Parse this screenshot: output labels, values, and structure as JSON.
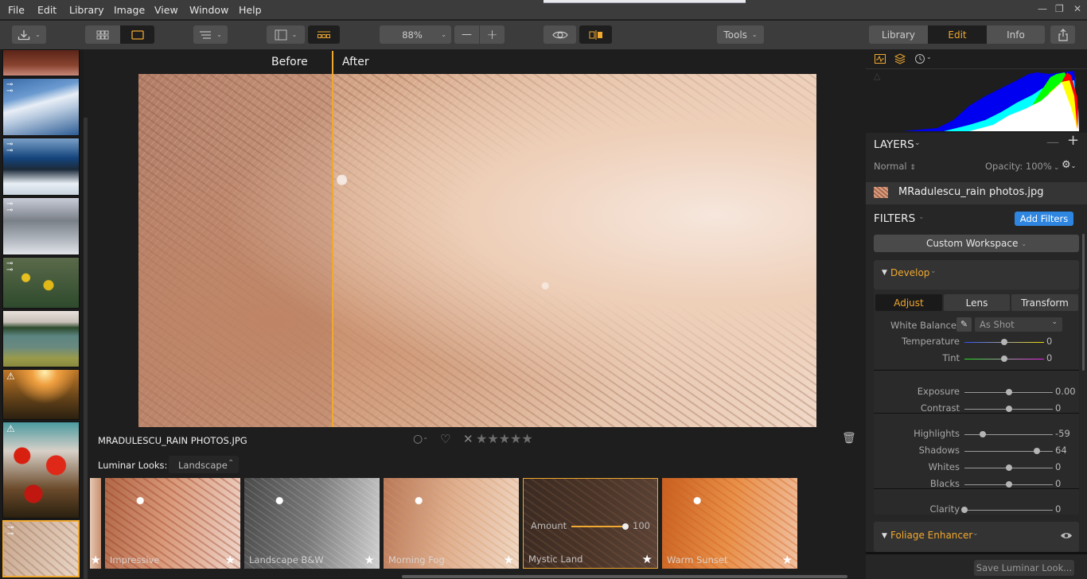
{
  "menu": [
    "File",
    "Edit",
    "Library",
    "Image",
    "View",
    "Window",
    "Help"
  ],
  "window_controls": {
    "minimize": "—",
    "restore": "❐",
    "close": "✕"
  },
  "toolbar": {
    "import_icon": "download-icon",
    "zoom_value": "88%",
    "zoom_out": "—",
    "zoom_in": "+",
    "tools_label": "Tools",
    "mode_tabs": [
      {
        "label": "Library",
        "active": false
      },
      {
        "label": "Edit",
        "active": true
      },
      {
        "label": "Info",
        "active": false
      }
    ]
  },
  "canvas": {
    "before_label": "Before",
    "after_label": "After",
    "filename": "MRADULESCU_RAIN PHOTOS.JPG",
    "rating_stars": 0
  },
  "looks": {
    "label": "Luminar Looks:",
    "category": "Landscape",
    "items": [
      {
        "name": "Impressive",
        "selected": false
      },
      {
        "name": "Landscape B&W",
        "selected": false
      },
      {
        "name": "Morning Fog",
        "selected": false
      },
      {
        "name": "Mystic Land",
        "selected": true,
        "amount_label": "Amount",
        "amount": 100
      },
      {
        "name": "Warm Sunset",
        "selected": false
      }
    ]
  },
  "filmstrip": [
    {
      "name": "forest-sunset",
      "badge": ""
    },
    {
      "name": "snowy-mountain",
      "badge": "edited"
    },
    {
      "name": "mountain-range",
      "badge": "edited"
    },
    {
      "name": "snowy-trees",
      "badge": "edited"
    },
    {
      "name": "yellow-flowers",
      "badge": "edited"
    },
    {
      "name": "lake",
      "badge": ""
    },
    {
      "name": "sunset-flowers",
      "badge": "warning"
    },
    {
      "name": "red-poppies",
      "badge": "warning"
    },
    {
      "name": "rain-photos",
      "badge": "edited",
      "selected": true
    }
  ],
  "panel": {
    "layers_title": "LAYERS",
    "blend_mode": "Normal",
    "opacity": "Opacity: 100%",
    "layer_name": "MRadulescu_rain photos.jpg",
    "filters_title": "FILTERS",
    "add_filters": "Add Filters",
    "workspace": "Custom Workspace",
    "develop": {
      "title": "Develop",
      "tabs": [
        {
          "label": "Adjust",
          "active": true
        },
        {
          "label": "Lens",
          "active": false
        },
        {
          "label": "Transform",
          "active": false
        }
      ],
      "white_balance_label": "White Balance",
      "white_balance_value": "As Shot",
      "sliders": [
        {
          "label": "Temperature",
          "value": "0",
          "pos": 0.5
        },
        {
          "label": "Tint",
          "value": "0",
          "pos": 0.5
        },
        {
          "label": "Exposure",
          "value": "0.00",
          "pos": 0.5
        },
        {
          "label": "Contrast",
          "value": "0",
          "pos": 0.5
        },
        {
          "label": "Highlights",
          "value": "-59",
          "pos": 0.205
        },
        {
          "label": "Shadows",
          "value": "64",
          "pos": 0.82
        },
        {
          "label": "Whites",
          "value": "0",
          "pos": 0.5
        },
        {
          "label": "Blacks",
          "value": "0",
          "pos": 0.5
        },
        {
          "label": "Clarity",
          "value": "0",
          "pos": 0.0
        }
      ]
    },
    "foliage_title": "Foliage Enhancer",
    "save_look": "Save Luminar Look..."
  }
}
